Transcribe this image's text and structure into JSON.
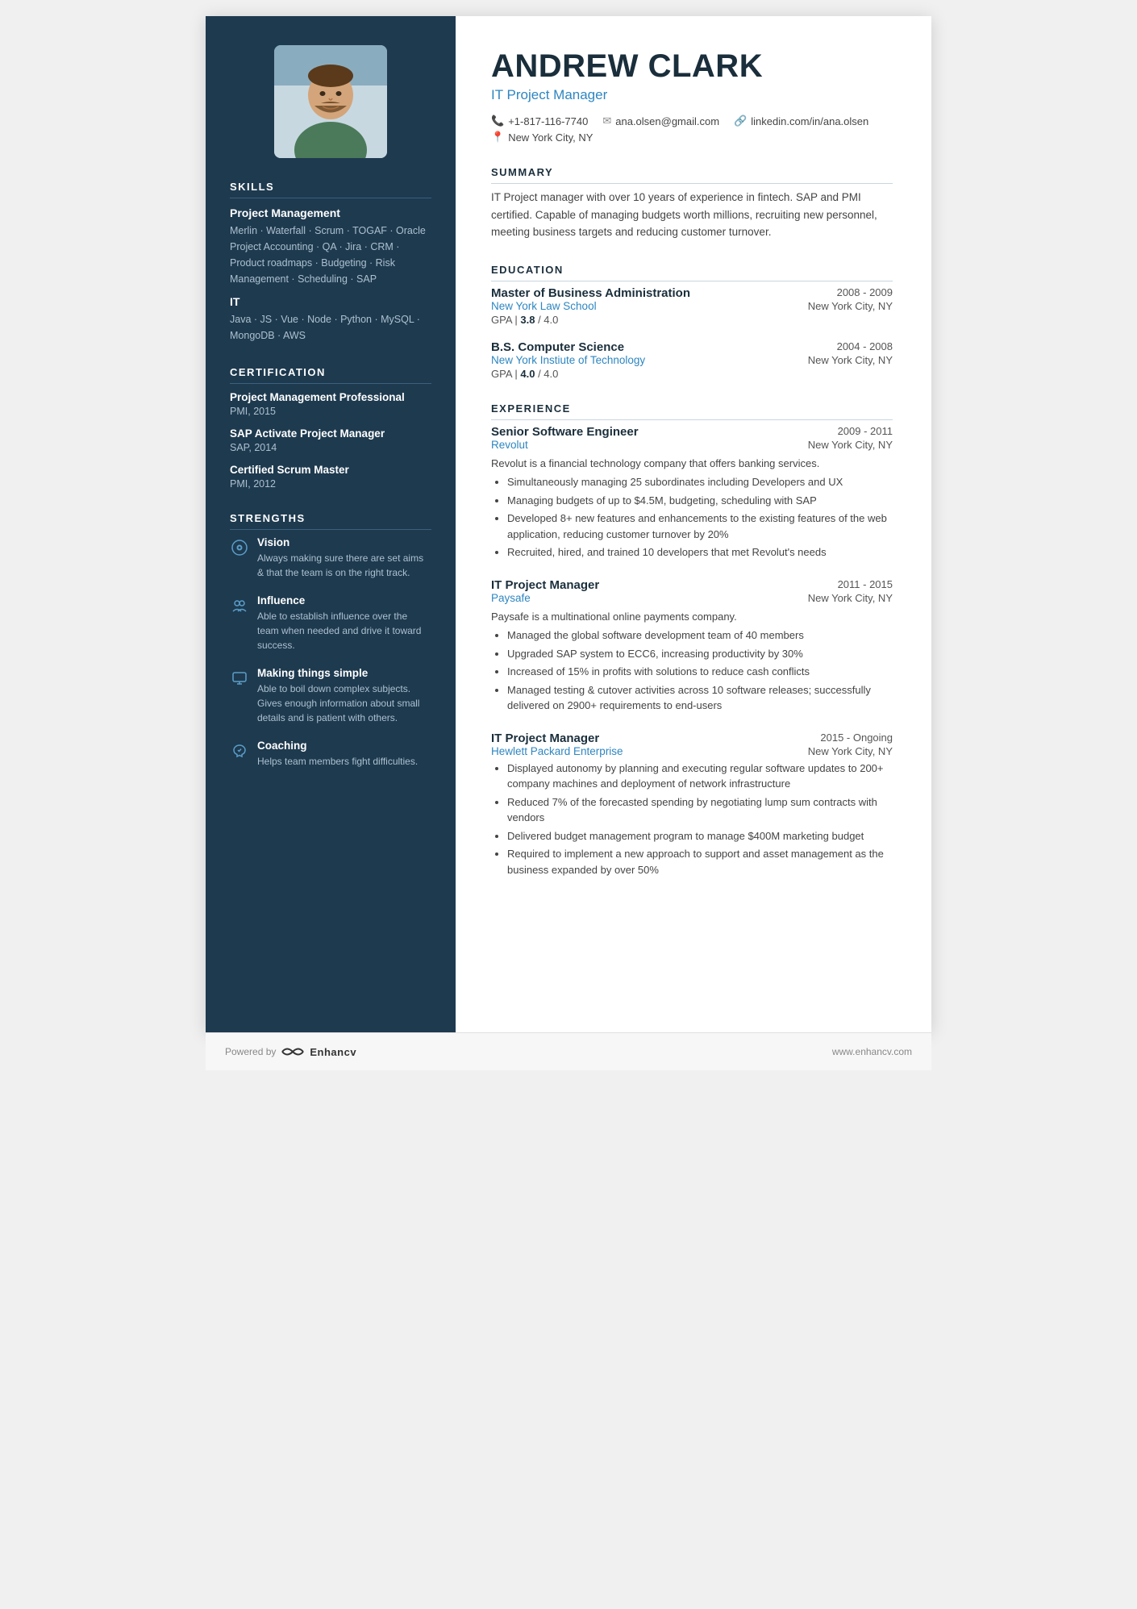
{
  "sidebar": {
    "skills": {
      "title": "SKILLS",
      "categories": [
        {
          "name": "Project Management",
          "skills": "Merlin · Waterfall · Scrum · TOGAF · Oracle Project Accounting · QA · Jira · CRM · Product roadmaps · Budgeting · Risk Management · Scheduling · SAP"
        },
        {
          "name": "IT",
          "skills": "Java · JS · Vue · Node · Python · MySQL · MongoDB · AWS"
        }
      ]
    },
    "certification": {
      "title": "CERTIFICATION",
      "items": [
        {
          "name": "Project Management Professional",
          "org": "PMI",
          "year": "2015"
        },
        {
          "name": "SAP Activate Project Manager",
          "org": "SAP",
          "year": "2014"
        },
        {
          "name": "Certified Scrum Master",
          "org": "PMI",
          "year": "2012"
        }
      ]
    },
    "strengths": {
      "title": "STRENGTHS",
      "items": [
        {
          "icon": "👁",
          "title": "Vision",
          "desc": "Always making sure there are set aims & that the team is on the right track."
        },
        {
          "icon": "👥",
          "title": "Influence",
          "desc": "Able to establish influence over the team when needed and drive it toward success."
        },
        {
          "icon": "🖥",
          "title": "Making things simple",
          "desc": "Able to boil down complex subjects. Gives enough information about small details and is patient with others."
        },
        {
          "icon": "🤝",
          "title": "Coaching",
          "desc": "Helps team members fight difficulties."
        }
      ]
    }
  },
  "main": {
    "name": "ANDREW CLARK",
    "job_title": "IT Project Manager",
    "contact": {
      "phone": "+1-817-116-7740",
      "email": "ana.olsen@gmail.com",
      "linkedin": "linkedin.com/in/ana.olsen",
      "location": "New York City, NY"
    },
    "summary": {
      "title": "SUMMARY",
      "text": "IT Project manager with over 10 years of experience in fintech. SAP and PMI certified. Capable of managing budgets worth millions, recruiting new personnel, meeting business targets and reducing customer turnover."
    },
    "education": {
      "title": "EDUCATION",
      "items": [
        {
          "degree": "Master of Business Administration",
          "school": "New York Law School",
          "location": "New York City, NY",
          "years": "2008 - 2009",
          "gpa": "3.8",
          "gpa_max": "4.0"
        },
        {
          "degree": "B.S. Computer Science",
          "school": "New York Instiute of Technology",
          "location": "New York City, NY",
          "years": "2004 - 2008",
          "gpa": "4.0",
          "gpa_max": "4.0"
        }
      ]
    },
    "experience": {
      "title": "EXPERIENCE",
      "items": [
        {
          "role": "Senior Software Engineer",
          "company": "Revolut",
          "location": "New York City, NY",
          "years": "2009 - 2011",
          "desc": "Revolut is a financial technology company that offers banking services.",
          "bullets": [
            "Simultaneously managing 25 subordinates including Developers and UX",
            "Managing budgets of up to $4.5M, budgeting, scheduling with SAP",
            "Developed 8+ new features and enhancements to the existing features of the web application, reducing customer turnover by 20%",
            "Recruited, hired, and trained 10 developers that met Revolut's needs"
          ]
        },
        {
          "role": "IT Project Manager",
          "company": "Paysafe",
          "location": "New York City, NY",
          "years": "2011 - 2015",
          "desc": "Paysafe is a multinational online payments company.",
          "bullets": [
            "Managed the global software development team of 40 members",
            "Upgraded SAP system to ECC6, increasing productivity by 30%",
            "Increased of 15% in profits with solutions to reduce cash conflicts",
            "Managed testing & cutover activities across 10 software releases; successfully delivered on 2900+ requirements to end-users"
          ]
        },
        {
          "role": "IT Project Manager",
          "company": "Hewlett Packard Enterprise",
          "location": "New York City, NY",
          "years": "2015 - Ongoing",
          "desc": "",
          "bullets": [
            "Displayed autonomy by planning and executing regular software updates to 200+ company machines and deployment of network infrastructure",
            "Reduced 7% of the forecasted spending by negotiating lump sum contracts with vendors",
            "Delivered budget management program to manage $400M marketing budget",
            "Required to implement a new approach to support and asset management as the business expanded by over 50%"
          ]
        }
      ]
    }
  },
  "footer": {
    "powered_by": "Powered by",
    "brand": "Enhancv",
    "website": "www.enhancv.com"
  }
}
